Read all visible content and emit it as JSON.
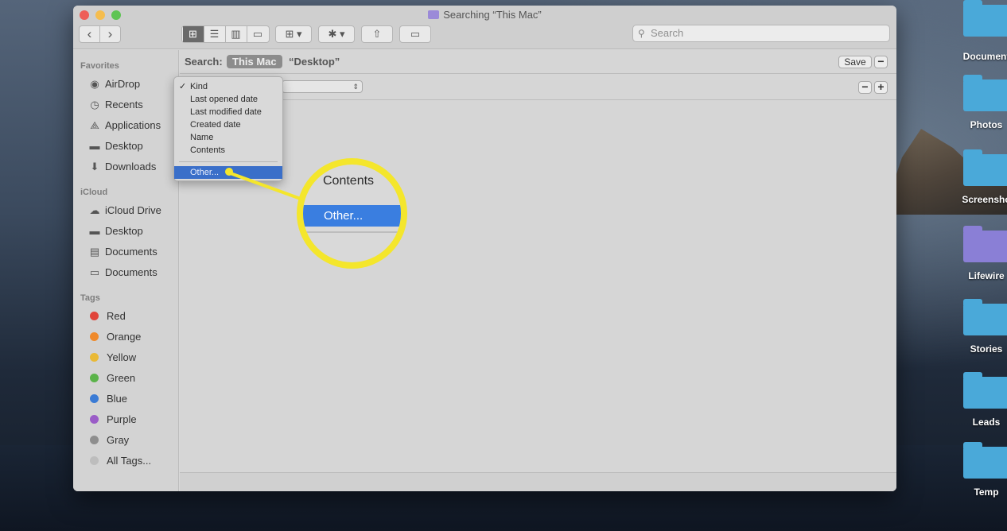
{
  "window": {
    "title": "Searching “This Mac”"
  },
  "toolbar": {
    "nav_back": "‹",
    "nav_forward": "›",
    "search_placeholder": "Search"
  },
  "sidebar": {
    "favorites_header": "Favorites",
    "favorites": [
      {
        "label": "AirDrop",
        "icon": "airdrop-icon"
      },
      {
        "label": "Recents",
        "icon": "clock-icon"
      },
      {
        "label": "Applications",
        "icon": "applications-icon"
      },
      {
        "label": "Desktop",
        "icon": "desktop-icon"
      },
      {
        "label": "Downloads",
        "icon": "download-icon"
      }
    ],
    "icloud_header": "iCloud",
    "icloud": [
      {
        "label": "iCloud Drive",
        "icon": "cloud-icon"
      },
      {
        "label": "Desktop",
        "icon": "desktop-icon"
      },
      {
        "label": "Documents",
        "icon": "document-icon"
      },
      {
        "label": "Documents",
        "icon": "folder-icon"
      }
    ],
    "tags_header": "Tags",
    "tags": [
      {
        "label": "Red",
        "color": "#e0443a"
      },
      {
        "label": "Orange",
        "color": "#ef8a2c"
      },
      {
        "label": "Yellow",
        "color": "#e9b936"
      },
      {
        "label": "Green",
        "color": "#5bb34a"
      },
      {
        "label": "Blue",
        "color": "#3a7bd5"
      },
      {
        "label": "Purple",
        "color": "#9a5cc7"
      },
      {
        "label": "Gray",
        "color": "#8e8e8e"
      },
      {
        "label": "All Tags...",
        "color": "#bdbdbd"
      }
    ]
  },
  "scope": {
    "label": "Search:",
    "this_mac": "This Mac",
    "desktop": "“Desktop”",
    "save": "Save",
    "minus": "−",
    "plus": "+"
  },
  "menu": {
    "items": [
      "Kind",
      "Last opened date",
      "Last modified date",
      "Created date",
      "Name",
      "Contents"
    ],
    "checked": "Kind",
    "other": "Other..."
  },
  "callout": {
    "contents": "Contents",
    "other": "Other..."
  },
  "desktop_folders": [
    "Document",
    "Photos",
    "Screensho",
    "Lifewire",
    "Stories",
    "Leads",
    "Temp"
  ],
  "colors": {
    "highlight": "#3a6fc9",
    "callout": "#f4e62c"
  }
}
